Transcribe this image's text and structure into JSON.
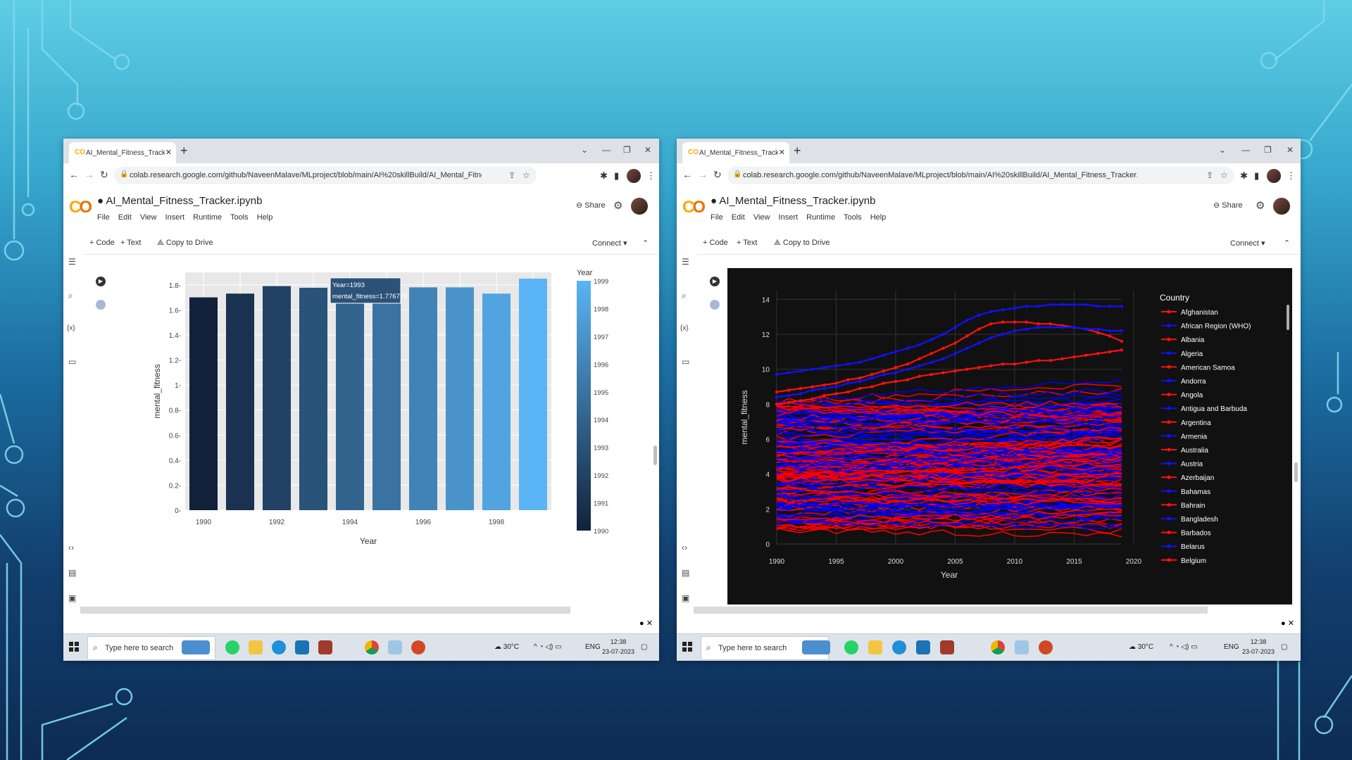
{
  "left_window": {
    "tab_title": "AI_Mental_Fitness_Tracker.ipynb",
    "url": "colab.research.google.com/github/NaveenMalave/MLproject/blob/main/AI%20skillBuild/AI_Mental_Fitness_Tracker.ipynb",
    "notebook_name": "AI_Mental_Fitness_Tracker.ipynb",
    "menu": [
      "File",
      "Edit",
      "View",
      "Insert",
      "Runtime",
      "Tools",
      "Help"
    ],
    "share_label": "Share",
    "code_btn": "+ Code",
    "text_btn": "+ Text",
    "copy_drive": "Copy to Drive",
    "connect": "Connect"
  },
  "right_window": {
    "tab_title": "AI_Mental_Fitness_Tracker.ipynb",
    "url": "colab.research.google.com/github/NaveenMalave/MLproject/blob/main/AI%20skillBuild/AI_Mental_Fitness_Tracker.ipynb",
    "notebook_name": "AI_Mental_Fitness_Tracker.ipynb",
    "menu": [
      "File",
      "Edit",
      "View",
      "Insert",
      "Runtime",
      "Tools",
      "Help"
    ],
    "share_label": "Share",
    "code_btn": "+ Code",
    "text_btn": "+ Text",
    "copy_drive": "Copy to Drive",
    "connect": "Connect"
  },
  "taskbar": {
    "search_placeholder": "Type here to search",
    "temperature": "30°C",
    "language": "ENG",
    "time": "12:38",
    "date": "23-07-2023"
  },
  "colors": {
    "colab_orange": "#f9ab00",
    "line_red": "#ff0000",
    "line_blue": "#0000ff"
  },
  "chart_data": [
    {
      "type": "bar",
      "xlabel": "Year",
      "ylabel": "mental_fitness",
      "categories": [
        1990,
        1991,
        1992,
        1993,
        1994,
        1995,
        1996,
        1997,
        1998,
        1999
      ],
      "values": [
        1.7,
        1.73,
        1.79,
        1.776779,
        1.72,
        1.74,
        1.78,
        1.78,
        1.73,
        1.85
      ],
      "ylim": [
        0,
        1.9
      ],
      "x_ticks": [
        "1990",
        "1992",
        "1994",
        "1996",
        "1998"
      ],
      "y_ticks": [
        "0",
        "0.2",
        "0.4",
        "0.6",
        "0.8",
        "1",
        "1.2",
        "1.4",
        "1.6",
        "1.8"
      ],
      "colorbar": {
        "title": "Year",
        "ticks": [
          "1999",
          "1998",
          "1997",
          "1996",
          "1995",
          "1994",
          "1993",
          "1992",
          "1991",
          "1990"
        ],
        "range": [
          1990,
          1999
        ],
        "colors": [
          "#11223a",
          "#5ab4f5"
        ]
      },
      "tooltip": {
        "line1": "Year=1993",
        "line2": "mental_fitness=1.776779"
      }
    },
    {
      "type": "line",
      "xlabel": "Year",
      "ylabel": "mental_fitness",
      "xlim": [
        1990,
        2019
      ],
      "ylim": [
        0,
        14.5
      ],
      "x_ticks": [
        "1990",
        "1995",
        "2000",
        "2005",
        "2010",
        "2015",
        "2020"
      ],
      "y_ticks": [
        "0",
        "2",
        "4",
        "6",
        "8",
        "10",
        "12",
        "14"
      ],
      "legend_title": "Country",
      "legend": [
        "Afghanistan",
        "African Region (WHO)",
        "Albania",
        "Algeria",
        "American Samoa",
        "Andorra",
        "Angola",
        "Antigua and Barbuda",
        "Argentina",
        "Armenia",
        "Australia",
        "Austria",
        "Azerbaijan",
        "Bahamas",
        "Bahrain",
        "Bangladesh",
        "Barbados",
        "Belarus",
        "Belgium"
      ],
      "legend_colors": [
        "red",
        "blue",
        "red",
        "blue",
        "red",
        "blue",
        "red",
        "blue",
        "red",
        "blue",
        "red",
        "blue",
        "red",
        "blue",
        "red",
        "blue",
        "red",
        "blue",
        "red"
      ],
      "highlighted_series": [
        {
          "color": "blue",
          "values": [
            9.7,
            9.8,
            9.9,
            10.0,
            10.1,
            10.2,
            10.3,
            10.4,
            10.6,
            10.8,
            11.0,
            11.2,
            11.4,
            11.7,
            12.0,
            12.4,
            12.8,
            13.1,
            13.3,
            13.4,
            13.5,
            13.6,
            13.6,
            13.7,
            13.7,
            13.7,
            13.7,
            13.6,
            13.6,
            13.6
          ]
        },
        {
          "color": "red",
          "values": [
            8.7,
            8.8,
            8.9,
            9.0,
            9.1,
            9.2,
            9.4,
            9.5,
            9.7,
            9.9,
            10.1,
            10.3,
            10.6,
            10.9,
            11.2,
            11.5,
            11.9,
            12.3,
            12.6,
            12.7,
            12.7,
            12.7,
            12.6,
            12.6,
            12.5,
            12.4,
            12.3,
            12.1,
            11.9,
            11.6
          ]
        },
        {
          "color": "blue",
          "values": [
            8.4,
            8.5,
            8.6,
            8.8,
            8.9,
            9.0,
            9.2,
            9.3,
            9.5,
            9.7,
            9.8,
            10.0,
            10.2,
            10.4,
            10.6,
            10.9,
            11.2,
            11.5,
            11.8,
            12.0,
            12.2,
            12.3,
            12.4,
            12.4,
            12.4,
            12.4,
            12.3,
            12.3,
            12.2,
            12.2
          ]
        },
        {
          "color": "red",
          "values": [
            8.0,
            8.1,
            8.2,
            8.3,
            8.5,
            8.6,
            8.7,
            8.9,
            9.0,
            9.2,
            9.3,
            9.4,
            9.6,
            9.7,
            9.8,
            9.9,
            10.0,
            10.1,
            10.2,
            10.3,
            10.3,
            10.4,
            10.5,
            10.5,
            10.6,
            10.7,
            10.8,
            10.9,
            11.0,
            11.1
          ]
        }
      ],
      "background_series_count": 160
    }
  ]
}
